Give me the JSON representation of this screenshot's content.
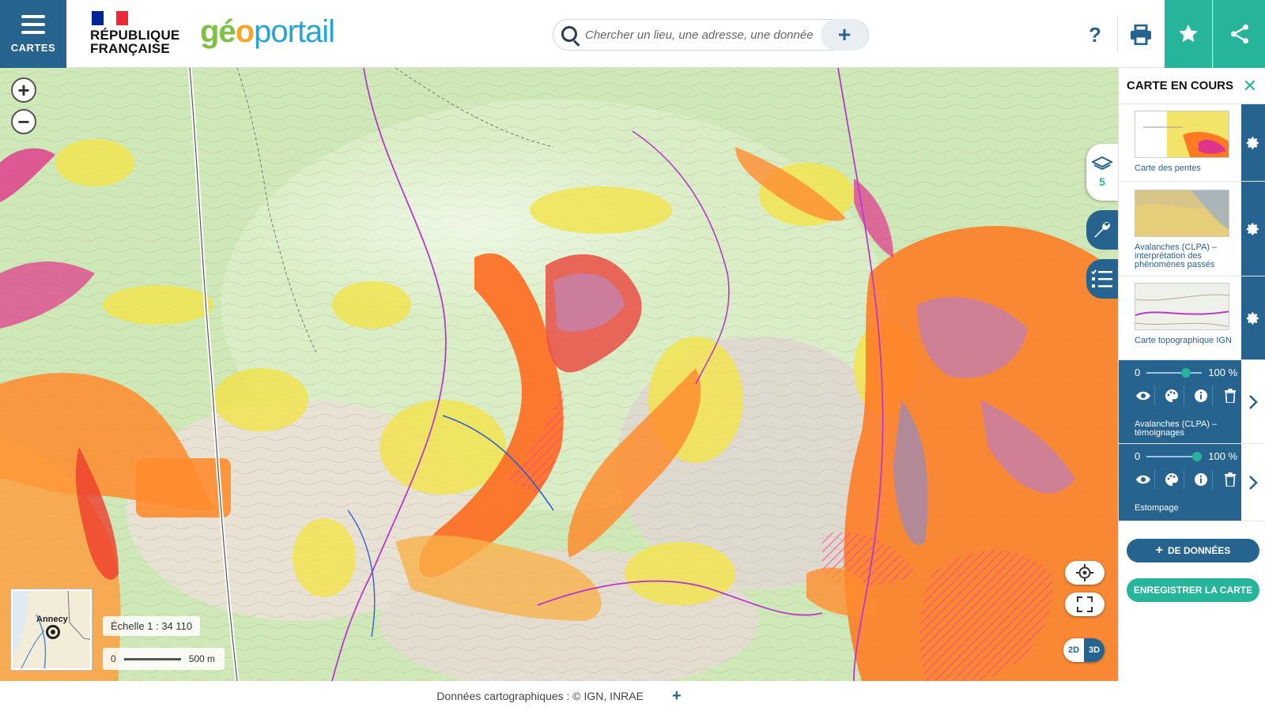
{
  "header": {
    "menu_label": "CARTES",
    "rf_line1": "RÉPUBLIQUE",
    "rf_line2": "FRANÇAISE",
    "logo_part1": "gé",
    "logo_part2": "o",
    "logo_part3": "portail",
    "search_placeholder": "Chercher un lieu, une adresse, une donnée",
    "search_add": "+",
    "help": "?"
  },
  "map": {
    "zoom_in": "+",
    "zoom_out": "−",
    "overview_label": "Annecy",
    "scale_text": "Échelle 1 : 34 110",
    "scale_zero": "0",
    "scale_distance": "500 m",
    "mode_2d": "2D",
    "mode_3d": "3D",
    "layers_count": "5"
  },
  "panel": {
    "title": "CARTE EN COURS",
    "layers": [
      {
        "name": "Carte des pentes"
      },
      {
        "name": "Avalanches (CLPA) – interprétation des phénomènes passés"
      },
      {
        "name": "Carte topographique IGN"
      }
    ],
    "active_layers": [
      {
        "name": "Avalanches (CLPA) – témoignages",
        "opacity_min": "0",
        "opacity": "100 %",
        "opacity_fraction": 0.75
      },
      {
        "name": "Estompage",
        "opacity_min": "0",
        "opacity": "100 %",
        "opacity_fraction": 1.0
      }
    ],
    "add_data": "DE DONNÉES",
    "add_data_plus": "+",
    "save_map": "ENREGISTRER LA CARTE"
  },
  "footer": {
    "credits": "Données cartographiques : © IGN, INRAE",
    "plus": "+"
  },
  "colors": {
    "primary": "#26638f",
    "accent": "#26b59b"
  }
}
